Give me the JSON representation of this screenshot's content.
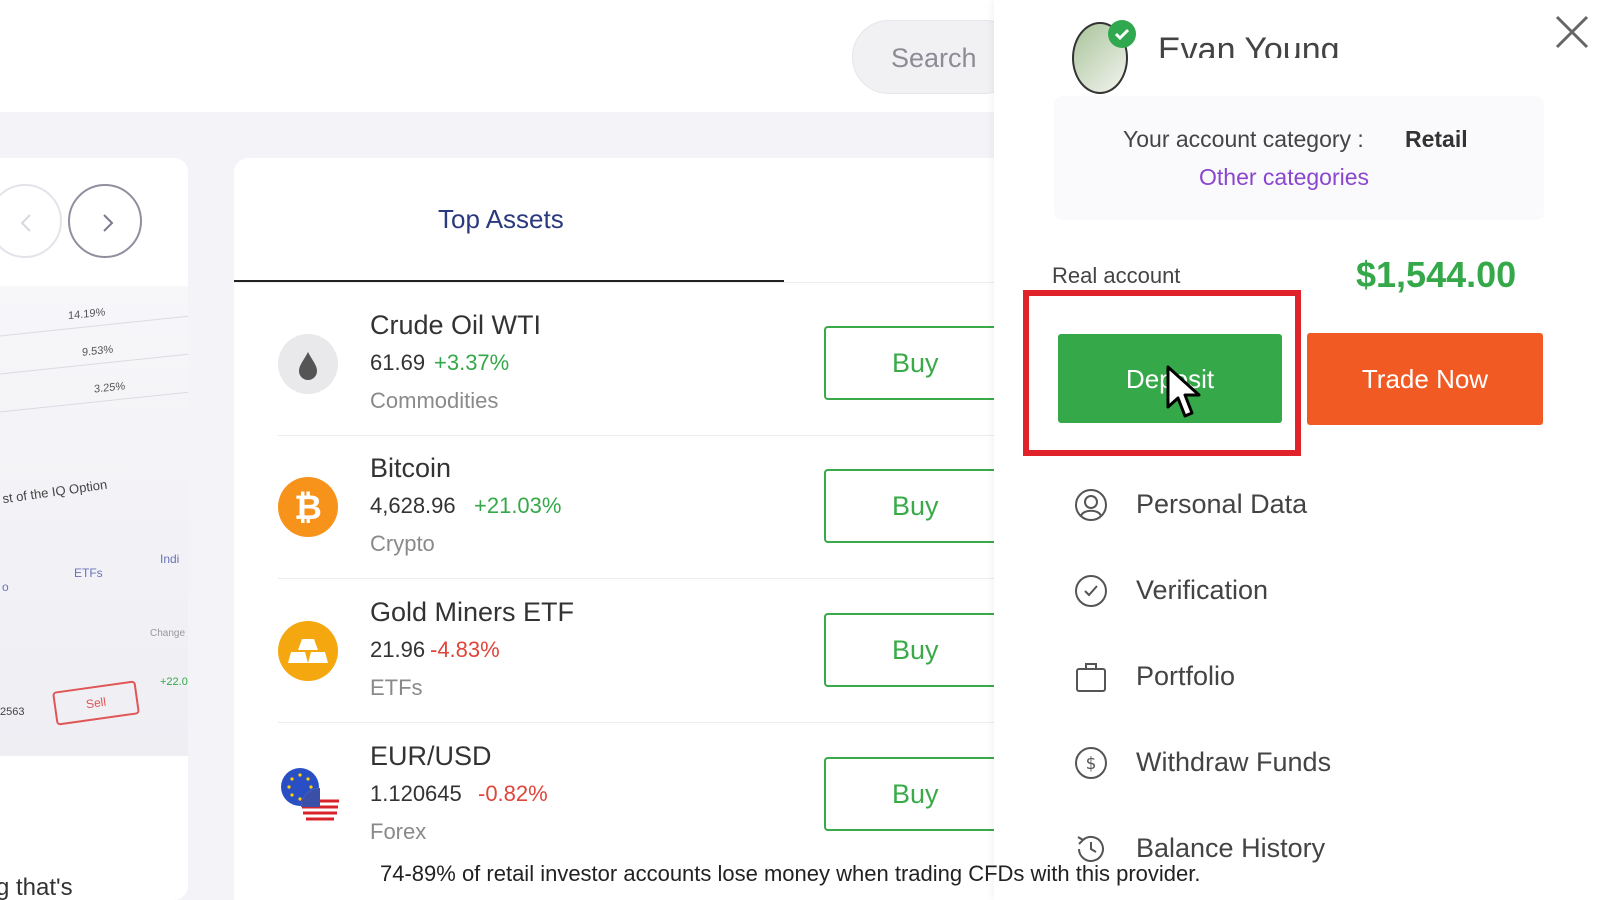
{
  "header": {
    "search_placeholder": "Search"
  },
  "promo": {
    "percents": [
      "14.19%",
      "9.53%",
      "3.25%"
    ],
    "snippet": "st of the IQ Option",
    "tabs": [
      "o",
      "ETFs",
      "Indi"
    ],
    "change_label": "Change",
    "sell_label": "Sell",
    "change_value": "+22.0",
    "id_fragment": "2563",
    "bottom_text": "g that's"
  },
  "assets": {
    "tab_label": "Top Assets",
    "buy_label": "Buy",
    "items": [
      {
        "name": "Crude Oil WTI",
        "price": "61.69",
        "change": "+3.37%",
        "category": "Commodities",
        "icon": "oil-drop-icon",
        "change_color": "#35a849"
      },
      {
        "name": "Bitcoin",
        "price": "4,628.96",
        "change": "+21.03%",
        "category": "Crypto",
        "icon": "bitcoin-icon",
        "change_color": "#35a849"
      },
      {
        "name": "Gold Miners ETF",
        "price": "21.96",
        "change": "-4.83%",
        "category": "ETFs",
        "icon": "gold-bars-icon",
        "change_color": "#e0443a"
      },
      {
        "name": "EUR/USD",
        "price": "1.120645",
        "change": "-0.82%",
        "category": "Forex",
        "icon": "eu-us-flags-icon",
        "change_color": "#e0443a"
      }
    ]
  },
  "profile": {
    "name": "Evan Young",
    "category_label": "Your account category : ",
    "category_value": "Retail",
    "other_categories": "Other categories",
    "account_label": "Real account",
    "balance": "$1,544.00",
    "deposit_label": "Deposit",
    "trade_label": "Trade Now",
    "menu": [
      {
        "label": "Personal Data",
        "icon": "person-icon"
      },
      {
        "label": "Verification",
        "icon": "check-circle-icon"
      },
      {
        "label": "Portfolio",
        "icon": "briefcase-icon"
      },
      {
        "label": "Withdraw Funds",
        "icon": "dollar-circle-icon"
      },
      {
        "label": "Balance History",
        "icon": "history-icon"
      }
    ]
  },
  "disclaimer": "74-89% of retail investor accounts lose money when trading CFDs with this provider.",
  "colors": {
    "green": "#35a849",
    "orange": "#f25a24",
    "highlight_red": "#e0222b",
    "link_purple": "#8a46cf"
  }
}
